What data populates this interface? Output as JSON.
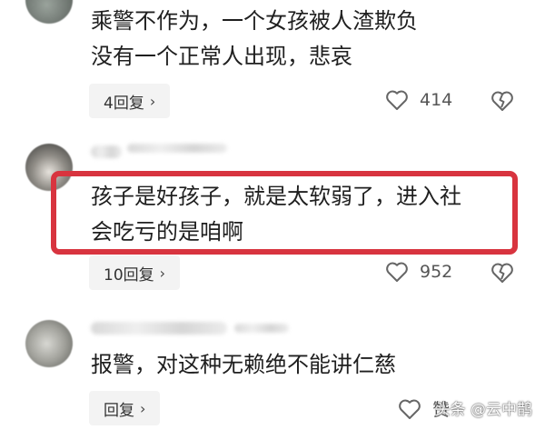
{
  "comments": [
    {
      "text": "乘警不作为，一个女孩被人渣欺负\n没有一个正常人出现，悲哀",
      "reply_label": "4回复",
      "likes": "414"
    },
    {
      "text": "孩子是好孩子，就是太软弱了，进入社\n会吃亏的是咱啊",
      "reply_label": "10回复",
      "likes": "952"
    },
    {
      "text": "报警，对这种无赖绝不能讲仁慈",
      "reply_label": "回复",
      "likes": "赞"
    }
  ],
  "watermark": "头条 @云中鹊",
  "colors": {
    "highlight": "#d8343f",
    "reply_bg": "#f3f3f3"
  },
  "icons": [
    "heart-icon",
    "broken-heart-icon",
    "chevron-right-icon"
  ]
}
